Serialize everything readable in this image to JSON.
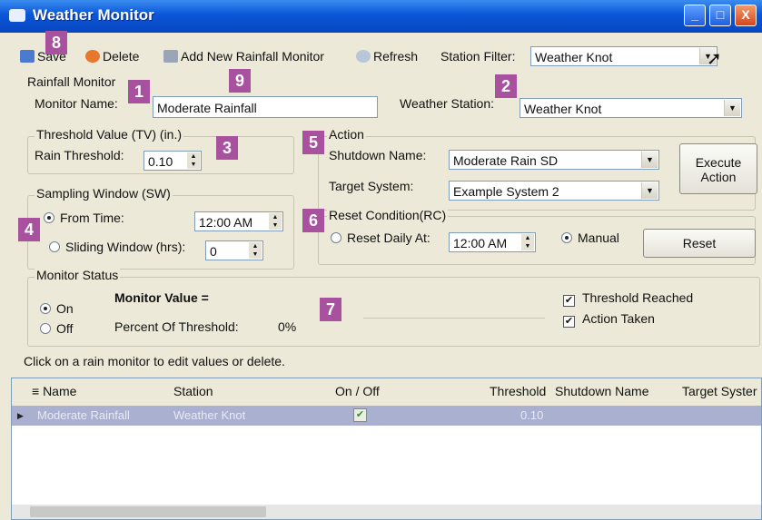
{
  "window": {
    "title": "Weather Monitor",
    "minimize": "_",
    "maximize": "□",
    "close": "X"
  },
  "toolbar": {
    "save": "Save",
    "delete": "Delete",
    "add_new": "Add New Rainfall Monitor",
    "refresh": "Refresh",
    "station_filter_label": "Station Filter:",
    "station_filter_value": "Weather Knot"
  },
  "rainfall_monitor": {
    "group_label": "Rainfall Monitor",
    "monitor_name_label": "Monitor Name:",
    "monitor_name_value": "Moderate Rainfall",
    "weather_station_label": "Weather Station:",
    "weather_station_value": "Weather Knot"
  },
  "threshold": {
    "group_label": "Threshold Value (TV)  (in.)",
    "rain_label": "Rain Threshold:",
    "rain_value": "0.10"
  },
  "sampling": {
    "group_label": "Sampling Window (SW)",
    "from_time_label": "From Time:",
    "from_time_value": "12:00 AM",
    "sliding_label": "Sliding Window (hrs):",
    "sliding_value": "0"
  },
  "action": {
    "group_label": "Action",
    "shutdown_label": "Shutdown Name:",
    "shutdown_value": "Moderate Rain SD",
    "target_label": "Target System:",
    "target_value": "Example System 2",
    "execute_button": "Execute Action"
  },
  "reset": {
    "group_label": "Reset Condition(RC)",
    "daily_label": "Reset Daily At:",
    "daily_value": "12:00 AM",
    "manual_label": "Manual",
    "reset_button": "Reset"
  },
  "status": {
    "group_label": "Monitor Status",
    "on_label": "On",
    "off_label": "Off",
    "monitor_value_label": "Monitor Value =",
    "percent_label": "Percent Of Threshold:",
    "percent_value": "0%",
    "threshold_reached_label": "Threshold Reached",
    "action_taken_label": "Action Taken"
  },
  "hint": "Click on a rain monitor to edit values or delete.",
  "grid": {
    "headers": [
      "Name",
      "Station",
      "On / Off",
      "Threshold",
      "Shutdown Name",
      "Target Syster"
    ],
    "rows": [
      {
        "name": "Moderate Rainfall",
        "station": "Weather Knot",
        "threshold": "0.10"
      }
    ]
  },
  "badges": [
    "1",
    "2",
    "3",
    "4",
    "5",
    "6",
    "7",
    "8",
    "9"
  ],
  "colors": {
    "badge": "#a8519e",
    "titlebar": "#0a56d8",
    "selected_row": "#aab0cf"
  }
}
